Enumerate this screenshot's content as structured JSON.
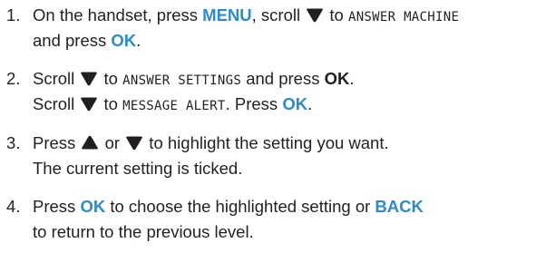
{
  "steps": [
    {
      "number": "1.",
      "l1_a": "On the handset, press ",
      "l1_menu": "MENU",
      "l1_b": ", scroll ",
      "l1_c": " to ",
      "l1_screen": "ANSWER MACHINE",
      "l2_a": "and press ",
      "l2_ok": "OK",
      "l2_b": "."
    },
    {
      "number": "2.",
      "l1_a": "Scroll ",
      "l1_b": " to ",
      "l1_screen": "ANSWER SETTINGS",
      "l1_c": " and press ",
      "l1_ok": "OK",
      "l1_d": ".",
      "l2_a": "Scroll ",
      "l2_b": " to ",
      "l2_screen": "MESSAGE ALERT",
      "l2_c": ". Press ",
      "l2_ok": "OK",
      "l2_d": "."
    },
    {
      "number": "3.",
      "l1_a": "Press ",
      "l1_b": " or ",
      "l1_c": " to highlight the setting you want.",
      "l2": "The current setting is ticked."
    },
    {
      "number": "4.",
      "l1_a": "Press ",
      "l1_ok": "OK",
      "l1_b": " to choose the highlighted setting or ",
      "l1_back": "BACK",
      "l2": "to return to the previous level."
    }
  ],
  "icons": {
    "scroll_down": "down-triangle",
    "scroll_up": "up-triangle"
  },
  "colors": {
    "key_highlight": "#2e8bcb",
    "text": "#231f20"
  }
}
